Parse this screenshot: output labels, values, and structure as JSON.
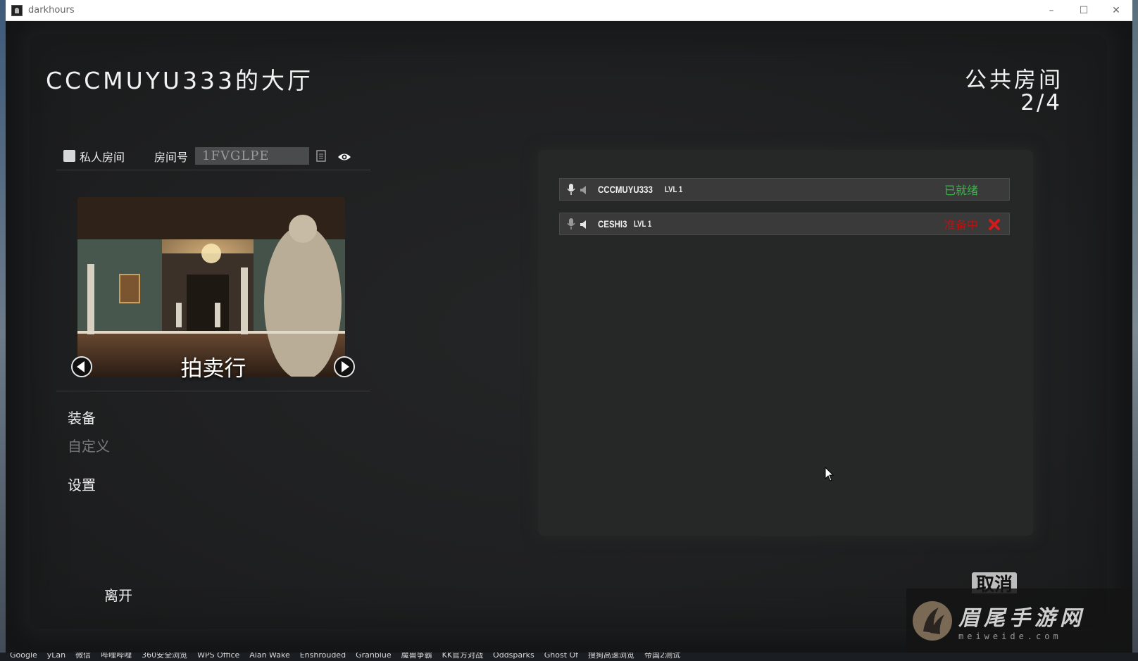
{
  "window": {
    "title": "darkhours",
    "minimize": "–",
    "maximize": "☐",
    "close": "✕"
  },
  "lobby": {
    "title": "CCCMUYU333的大厅",
    "room_type": "公共房间",
    "room_count": "2/4"
  },
  "room_options": {
    "private_label": "私人房间",
    "private_checked": false,
    "room_id_label": "房间号",
    "room_id_value": "1FVGLPE"
  },
  "map": {
    "name": "拍卖行"
  },
  "menu": {
    "equip": "装备",
    "custom": "自定义",
    "settings": "设置",
    "leave": "离开"
  },
  "players": [
    {
      "name": "CCCMUYU333",
      "level": "LVL 1",
      "status": "已就绪",
      "status_color": "#3ab54a"
    },
    {
      "name": "CESHI3",
      "level": "LVL 1",
      "status": "准备中",
      "status_color": "#c01010"
    }
  ],
  "cancel_label": "取消",
  "watermark": {
    "main": "眉尾手游网",
    "sub": "meiweide.com"
  },
  "taskbar": [
    "Google",
    "yLan",
    "微信",
    "哔哩哔哩",
    "360安全浏览",
    "WPS Office",
    "Alan Wake",
    "Enshrouded",
    "Granblue",
    "魔兽争霸",
    "KK官方对战",
    "Oddsparks",
    "Ghost Of",
    "搜狗高速浏览",
    "帝国2测试"
  ]
}
